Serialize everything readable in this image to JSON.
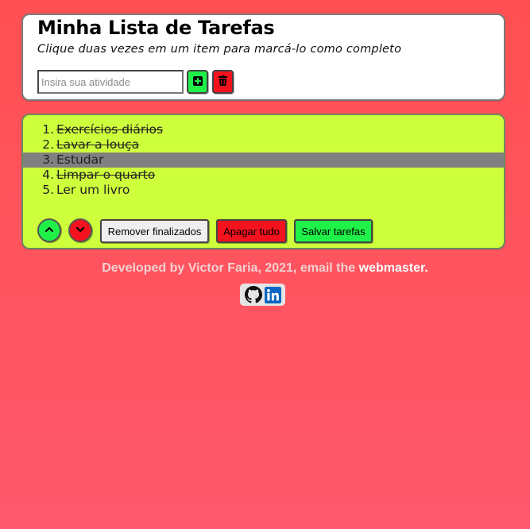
{
  "header": {
    "title": "Minha Lista de Tarefas",
    "subtitle": "Clique duas vezes em um item para marcá-lo como completo",
    "input_placeholder": "Insira sua atividade",
    "input_value": "",
    "add_icon": "plus-square-icon",
    "delete_icon": "trash-icon"
  },
  "tasks": [
    {
      "num": "1.",
      "text": "Exercícios diários",
      "done": true,
      "selected": false
    },
    {
      "num": "2.",
      "text": "Lavar a louça",
      "done": true,
      "selected": false
    },
    {
      "num": "3.",
      "text": "Estudar",
      "done": false,
      "selected": true
    },
    {
      "num": "4.",
      "text": "Limpar o quarto",
      "done": true,
      "selected": false
    },
    {
      "num": "5.",
      "text": "Ler um livro",
      "done": false,
      "selected": false
    }
  ],
  "controls": {
    "move_up_icon": "chevron-up-icon",
    "move_down_icon": "chevron-down-icon",
    "remove_finished": "Remover finalizados",
    "clear_all": "Apagar tudo",
    "save_tasks": "Salvar tarefas"
  },
  "footer": {
    "text": "Developed by Victor Faria, 2021, email the ",
    "link": "webmaster.",
    "icons": [
      "github-icon",
      "linkedin-icon"
    ]
  },
  "colors": {
    "background": "#ff4f51",
    "list_background": "#ceff3c",
    "green": "#1ff148",
    "red": "#f4121e",
    "selected_row": "#808080"
  }
}
